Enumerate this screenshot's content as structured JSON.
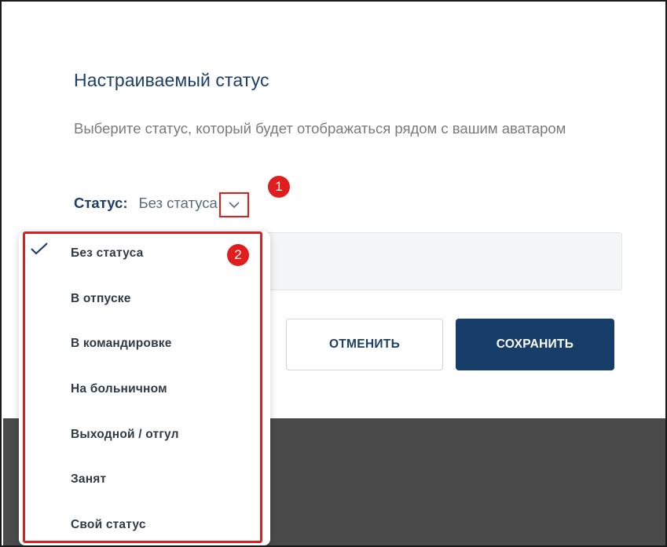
{
  "dialog": {
    "title": "Настраиваемый статус",
    "description": "Выберите статус, который будет отображаться рядом с вашим аватаром",
    "status_label": "Статус:",
    "status_value": "Без статуса",
    "cancel_label": "ОТМЕНИТЬ",
    "save_label": "СОХРАНИТЬ"
  },
  "dropdown": {
    "selected": "Без статуса",
    "options": [
      "Без статуса",
      "В отпуске",
      "В командировке",
      "На больничном",
      "Выходной / отгул",
      "Занят",
      "Свой статус"
    ]
  },
  "annotations": {
    "badge_1": "1",
    "badge_2": "2",
    "highlight_color": "#e01e1e"
  },
  "colors": {
    "primary": "#163e69",
    "title": "#1d3f66",
    "backdrop": "#4a4a4a"
  }
}
